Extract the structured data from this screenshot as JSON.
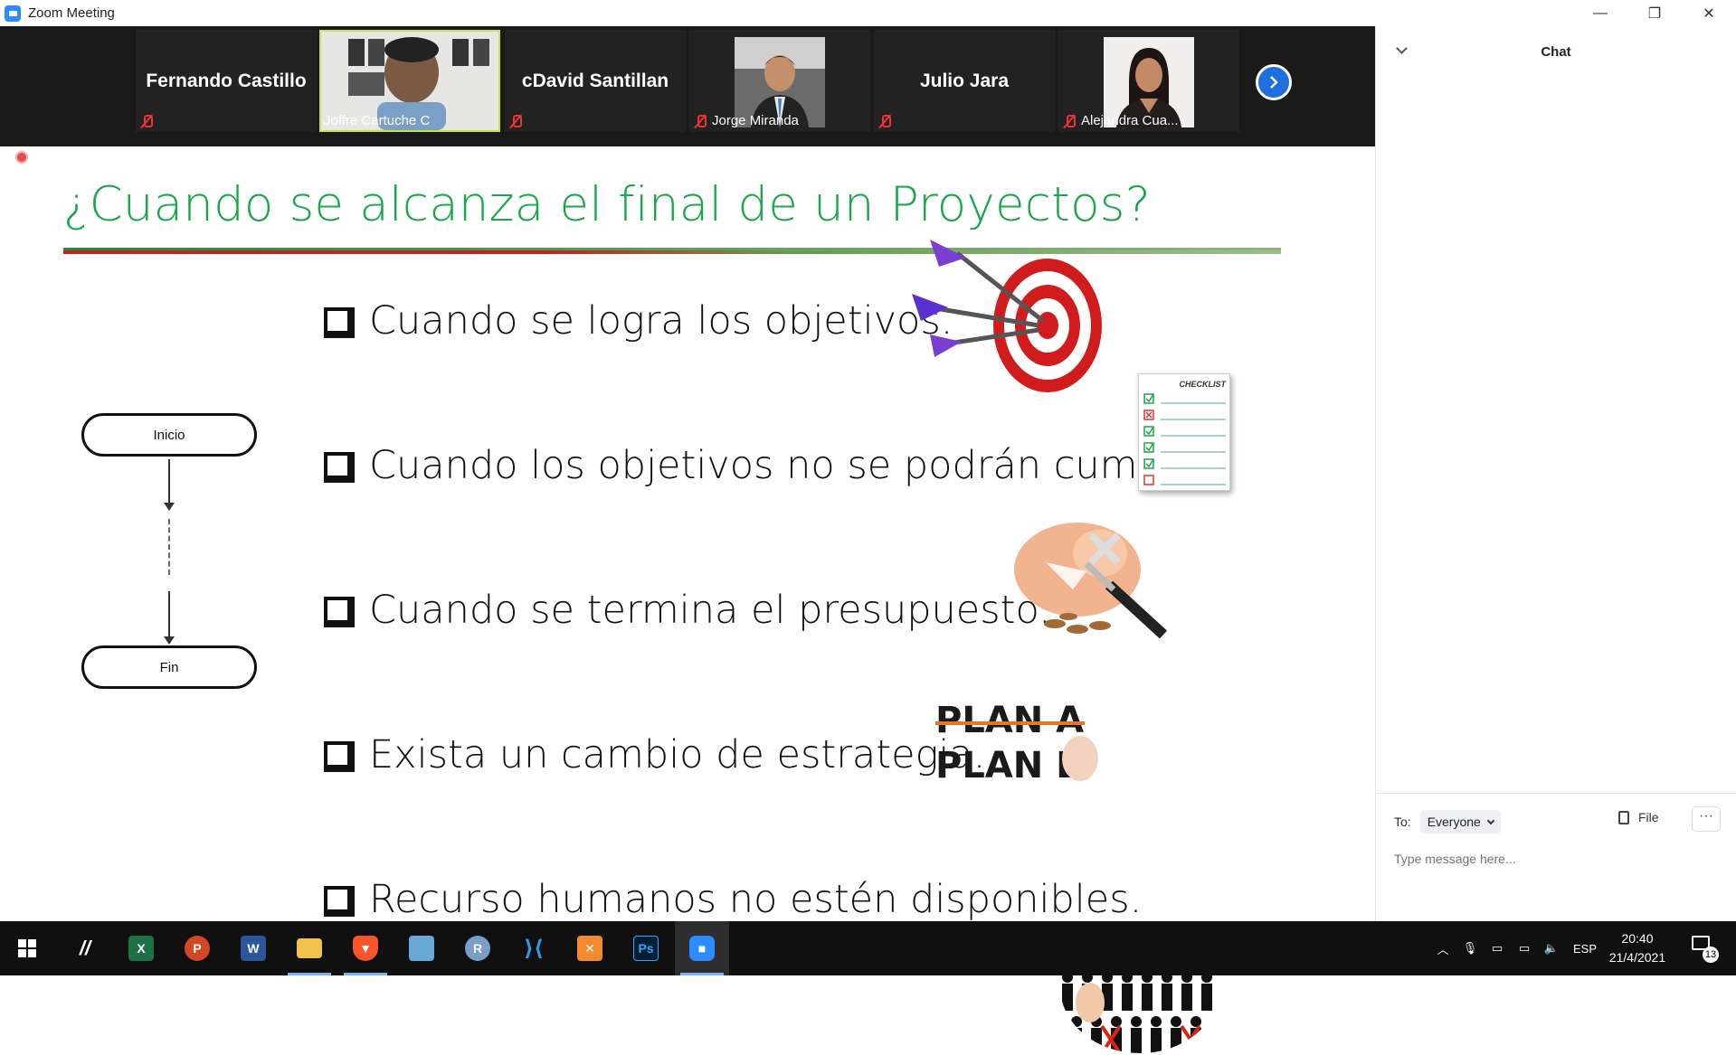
{
  "window": {
    "title": "Zoom Meeting"
  },
  "participants": [
    {
      "name": "Fernando Castillo",
      "label": "",
      "video": false
    },
    {
      "name": "",
      "label": "Joffre Cartuche C",
      "video": true,
      "active": true
    },
    {
      "name": "cDavid Santillan",
      "label": "",
      "video": false
    },
    {
      "name": "",
      "label": "Jorge Miranda",
      "video": true
    },
    {
      "name": "Julio Jara",
      "label": "",
      "video": false
    },
    {
      "name": "",
      "label": "Alejandra Cua...",
      "video": true
    }
  ],
  "slide": {
    "title": "¿Cuando se alcanza el final de un Proyectos?",
    "bullets": [
      "Cuando se logra los objetivos.",
      "Cuando los objetivos no se podrán cumplir.",
      "Cuando se termina el presupuesto.",
      "Exista un cambio de estrategia.",
      "Recurso humanos no estén disponibles."
    ],
    "flow": {
      "start": "Inicio",
      "end": "Fin"
    },
    "checklist_title": "CHECKLIST",
    "plan_a": "PLAN A",
    "plan_b": "PLAN B"
  },
  "chat": {
    "title": "Chat",
    "to_label": "To:",
    "to_value": "Everyone",
    "file_label": "File",
    "more_label": "···",
    "placeholder": "Type message here..."
  },
  "taskbar": {
    "language": "ESP",
    "time": "20:40",
    "date": "21/4/2021",
    "notifications": "13"
  },
  "colors": {
    "title_green": "#18a84a",
    "zoom_blue": "#2d8cff",
    "mute_red": "#e33333"
  }
}
